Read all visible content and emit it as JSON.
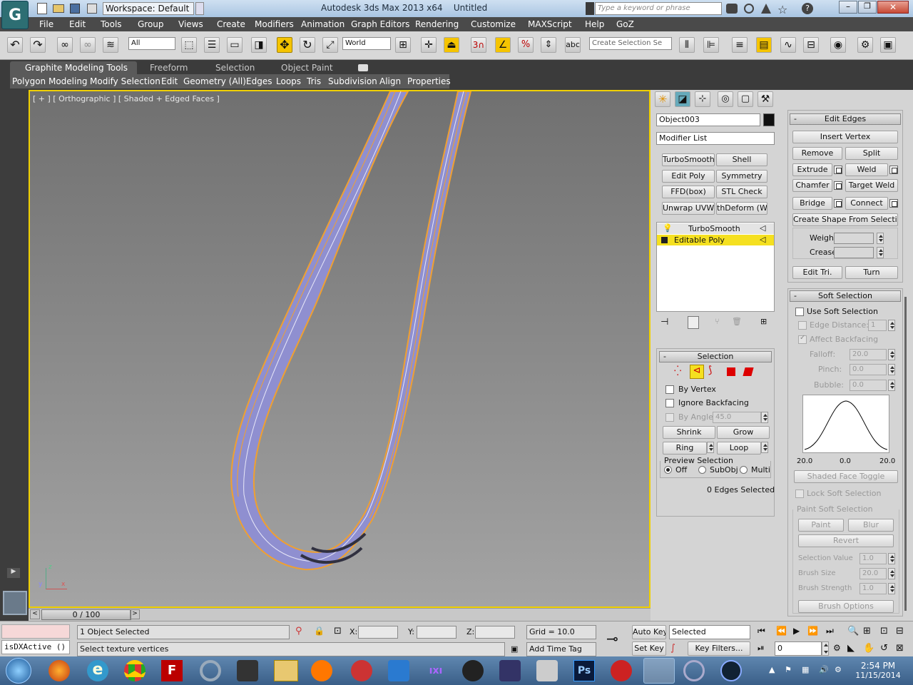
{
  "title": {
    "app": "Autodesk 3ds Max 2013 x64",
    "doc": "Untitled",
    "workspace": "Workspace: Default",
    "search_placeholder": "Type a keyword or phrase"
  },
  "menu": [
    "File",
    "Edit",
    "Tools",
    "Group",
    "Views",
    "Create",
    "Modifiers",
    "Animation",
    "Graph Editors",
    "Rendering",
    "Customize",
    "MAXScript",
    "Help",
    "GoZ"
  ],
  "toolbar": {
    "filter": "All",
    "refcoord": "World",
    "selset_placeholder": "Create Selection Se"
  },
  "ribbon": {
    "tabs": [
      "Graphite Modeling Tools",
      "Freeform",
      "Selection",
      "Object Paint"
    ],
    "subtabs": [
      "Polygon Modeling",
      "Modify Selection",
      "Edit",
      "Geometry (All)",
      "Edges",
      "Loops",
      "Tris",
      "Subdivision",
      "Align",
      "Properties"
    ]
  },
  "viewport": {
    "label": "[ + ] [ Orthographic ] [ Shaded + Edged Faces ]",
    "axis_x": "x",
    "axis_y": "y",
    "axis_z": "z"
  },
  "command": {
    "object_name": "Object003",
    "modifier_list": "Modifier List",
    "mod_buttons": [
      "TurboSmooth",
      "Shell",
      "Edit Poly",
      "Symmetry",
      "FFD(box)",
      "STL Check",
      "Unwrap UVW",
      "thDeform (WSI"
    ],
    "stack": [
      "TurboSmooth",
      "Editable Poly"
    ],
    "selection": {
      "title": "Selection",
      "by_vertex": "By Vertex",
      "ignore_backfacing": "Ignore Backfacing",
      "by_angle": "By Angle:",
      "angle_value": "45.0",
      "shrink": "Shrink",
      "grow": "Grow",
      "ring": "Ring",
      "loop": "Loop",
      "preview": "Preview Selection",
      "off": "Off",
      "subobj": "SubObj",
      "multi": "Multi",
      "status": "0 Edges Selected"
    }
  },
  "edit_edges": {
    "title": "Edit Edges",
    "insert_vertex": "Insert Vertex",
    "remove": "Remove",
    "split": "Split",
    "extrude": "Extrude",
    "weld": "Weld",
    "chamfer": "Chamfer",
    "target_weld": "Target Weld",
    "bridge": "Bridge",
    "connect": "Connect",
    "create_shape": "Create Shape From Selection",
    "weight": "Weight:",
    "crease": "Crease:",
    "edit_tri": "Edit Tri.",
    "turn": "Turn"
  },
  "soft_selection": {
    "title": "Soft Selection",
    "use": "Use Soft Selection",
    "edge_distance": "Edge Distance:",
    "edge_distance_val": "1",
    "affect_backfacing": "Affect Backfacing",
    "falloff": "Falloff:",
    "falloff_val": "20.0",
    "pinch": "Pinch:",
    "pinch_val": "0.0",
    "bubble": "Bubble:",
    "bubble_val": "0.0",
    "curve_left": "20.0",
    "curve_mid": "0.0",
    "curve_right": "20.0",
    "shaded_face_toggle": "Shaded Face Toggle",
    "lock": "Lock Soft Selection",
    "paint_group": "Paint Soft Selection",
    "paint": "Paint",
    "blur": "Blur",
    "revert": "Revert",
    "sel_value": "Selection Value",
    "sel_value_val": "1.0",
    "brush_size": "Brush Size",
    "brush_size_val": "20.0",
    "brush_strength": "Brush Strength",
    "brush_strength_val": "1.0",
    "brush_options": "Brush Options"
  },
  "timeline": {
    "frame": "0 / 100"
  },
  "status": {
    "selected": "1 Object Selected",
    "prompt": "Select texture vertices",
    "script": "isDXActive ()",
    "x_label": "X:",
    "y_label": "Y:",
    "z_label": "Z:",
    "grid": "Grid = 10.0",
    "add_time_tag": "Add Time Tag",
    "auto_key": "Auto Key",
    "set_key": "Set Key",
    "key_mode": "Selected",
    "key_filters": "Key Filters...",
    "frame_field": "0"
  },
  "taskbar": {
    "time": "2:54 PM",
    "date": "11/15/2014"
  }
}
